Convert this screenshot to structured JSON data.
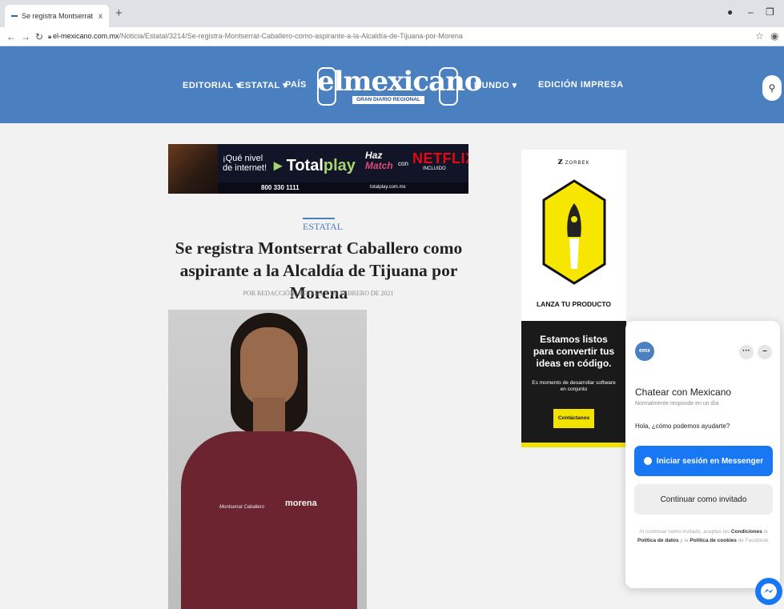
{
  "browser": {
    "tab_title": "Se registra Montserrat Caballero",
    "tab_close": "x",
    "new_tab": "+",
    "url_host": "el-mexicano.com.mx",
    "url_path": "/Noticia/Estatal/3214/Se-registra-Montserrat-Caballero-como-aspirante-a-la-Alcaldía-de-Tijuana-por-Morena",
    "minimize": "–",
    "restore": "❐"
  },
  "header": {
    "nav_left": [
      "EDITORIAL ▾",
      "ESTATAL ▾",
      "PAÍS"
    ],
    "nav_right": [
      "MUNDO ▾",
      "EDICIÓN IMPRESA"
    ],
    "logo_text": "elmexicano",
    "logo_tagline": "GRAN DIARIO REGIONAL",
    "bg_color": "#4a7fc0"
  },
  "ad": {
    "question": "¡Qué nivel de internet!",
    "brand_a": "Total",
    "brand_b": "play",
    "haz": "Haz",
    "match": "Match",
    "con": "con",
    "netflix": "NETFLIX",
    "incluido": "INCLUIDO",
    "phone": "800 330 1111",
    "site": "totalplay.com.mx"
  },
  "article": {
    "section": "ESTATAL",
    "headline": "Se registra Montserrat Caballero como aspirante a la Alcaldía de Tijuana por Morena",
    "byline": "POR REDACCIÓN | JUEVES, 4 DE FEBRERO DE 2021",
    "shirt_name": "Montserrat Caballero",
    "shirt_logo": "morena"
  },
  "sidebar_ad": {
    "brand": "ZORBEK",
    "brand_mark": "z",
    "tagline": "LANZA TU PRODUCTO",
    "title": "Estamos listos para convertir tus ideas en código.",
    "subtitle": "Es momento de desarrollar software en conjunto",
    "cta": "Contáctanos"
  },
  "chat": {
    "avatar_text": "emx",
    "more": "···",
    "minimize": "–",
    "name": "Chatear con Mexicano",
    "response_time": "Normalmente responde en un día",
    "greeting": "Hola, ¿cómo podemos ayudarte?",
    "login_button": "Iniciar sesión en Messenger",
    "guest_button": "Continuar como invitado",
    "legal_1": "Al continuar como invitado, aceptas las ",
    "legal_conditions": "Condiciones",
    "legal_2": " la ",
    "legal_data": "Política de datos",
    "legal_3": " y la ",
    "legal_cookies": "Política de cookies",
    "legal_4": " de Facebook."
  }
}
